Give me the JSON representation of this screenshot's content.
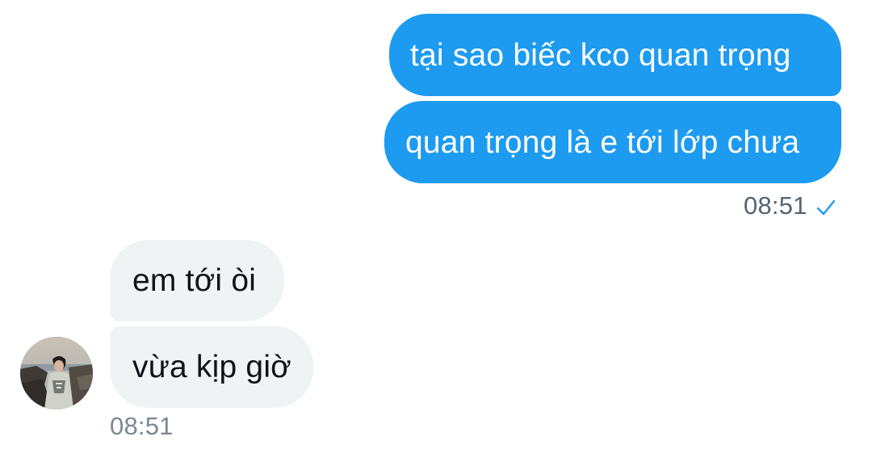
{
  "conversation": {
    "sent_messages": [
      {
        "text": "tại sao biếc kco quan trọng"
      },
      {
        "text": "quan trọng là e tới lớp chưa"
      }
    ],
    "sent_time": "08:51",
    "sent_status_icon": "check-icon",
    "received_messages": [
      {
        "text": "em tới òi"
      },
      {
        "text": "vừa kịp giờ"
      }
    ],
    "received_time": "08:51",
    "avatar_icon": "avatar-photo"
  },
  "colors": {
    "sent_bubble": "#1d9bf0",
    "received_bubble": "#eff3f4",
    "timestamp": "#536471",
    "check": "#1d9bf0"
  }
}
